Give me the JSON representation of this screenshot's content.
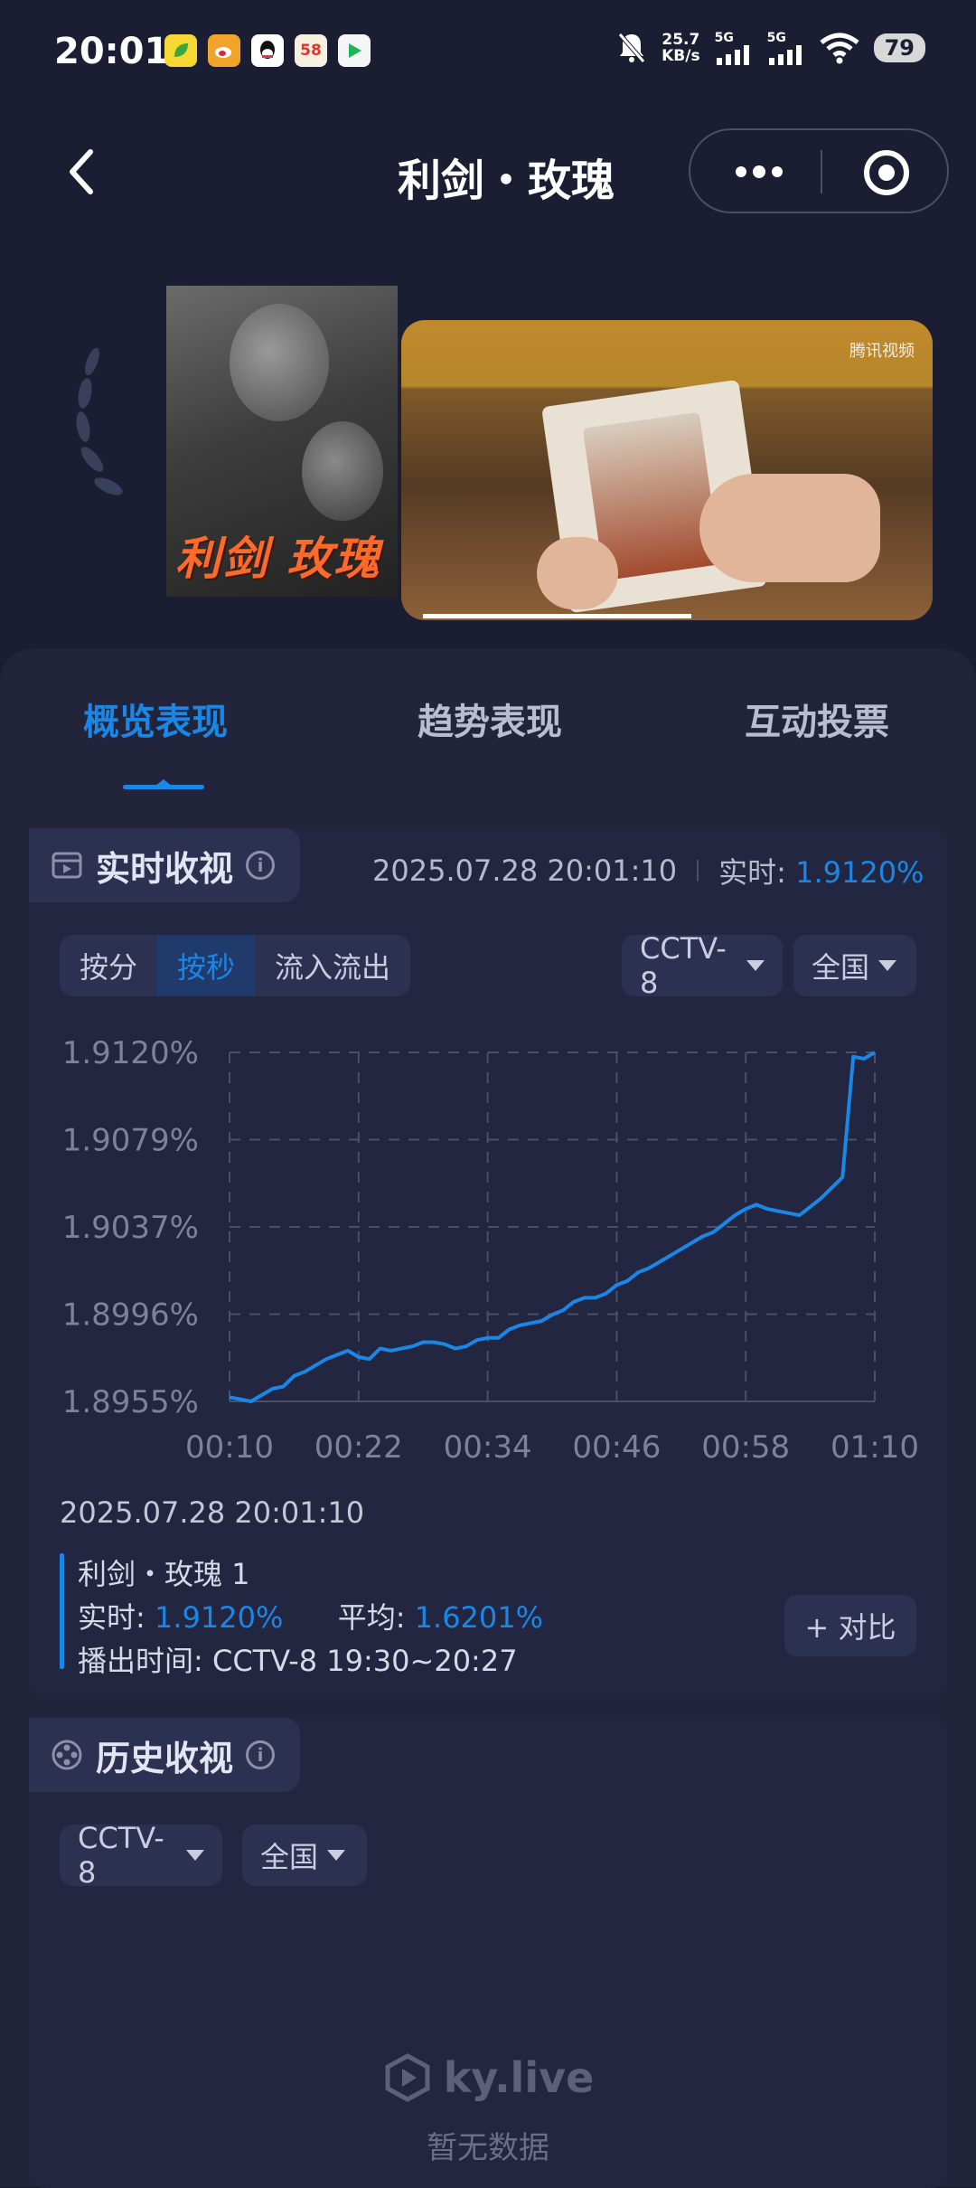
{
  "status_bar": {
    "time": "20:01",
    "net_speed_value": "25.7",
    "net_speed_unit": "KB/s",
    "signal_1": "5G",
    "signal_2": "5G",
    "battery": "79",
    "app_icons": [
      "leaf-app-icon",
      "weibo-icon",
      "qq-icon",
      "58-app-icon",
      "tencent-video-icon"
    ],
    "app_58_label": "58"
  },
  "nav": {
    "title": "利剑・玫瑰",
    "more_icon": "more-dots-icon",
    "record_icon": "target-icon"
  },
  "media": {
    "poster_title": "利剑 玫瑰",
    "watermark": "腾讯视频",
    "video_progress": 0.55
  },
  "tabs": [
    {
      "label": "概览表现",
      "active": true
    },
    {
      "label": "趋势表现",
      "active": false
    },
    {
      "label": "互动投票",
      "active": false
    }
  ],
  "realtime": {
    "title": "实时收视",
    "timestamp": "2025.07.28 20:01:10",
    "realtime_label": "实时:",
    "realtime_value": "1.9120%",
    "segments": [
      {
        "label": "按分",
        "active": false
      },
      {
        "label": "按秒",
        "active": true
      },
      {
        "label": "流入流出",
        "active": false
      }
    ],
    "channel": "CCTV-8",
    "region": "全国"
  },
  "chart_data": {
    "type": "line",
    "title": "",
    "xlabel": "",
    "ylabel": "",
    "x_ticks": [
      "00:10",
      "00:22",
      "00:34",
      "00:46",
      "00:58",
      "01:10"
    ],
    "y_ticks": [
      "1.9120%",
      "1.9079%",
      "1.9037%",
      "1.8996%",
      "1.8955%"
    ],
    "ylim": [
      1.8955,
      1.912
    ],
    "xlim": [
      10,
      70
    ],
    "grid": true,
    "color": "#1a87e6",
    "series": [
      {
        "x": [
          10,
          11,
          12,
          13,
          14,
          15,
          16,
          17,
          18,
          19,
          20,
          21,
          22,
          23,
          24,
          25,
          26,
          27,
          28,
          29,
          30,
          31,
          32,
          33,
          34,
          35,
          36,
          37,
          38,
          39,
          40,
          41,
          42,
          43,
          44,
          45,
          46,
          47,
          48,
          49,
          50,
          51,
          52,
          53,
          54,
          55,
          56,
          57,
          58,
          59,
          60,
          61,
          62,
          63,
          64,
          65,
          66,
          67,
          68,
          69,
          70
        ],
        "y": [
          1.8957,
          1.8956,
          1.8955,
          1.8958,
          1.8961,
          1.8962,
          1.8967,
          1.8969,
          1.8972,
          1.8975,
          1.8977,
          1.8979,
          1.8976,
          1.8975,
          1.898,
          1.8979,
          1.898,
          1.8981,
          1.8983,
          1.8983,
          1.8982,
          1.898,
          1.8981,
          1.8984,
          1.8985,
          1.8985,
          1.8989,
          1.8991,
          1.8992,
          1.8993,
          1.8996,
          1.8998,
          1.9002,
          1.9004,
          1.9004,
          1.9006,
          1.901,
          1.9012,
          1.9016,
          1.9018,
          1.9021,
          1.9024,
          1.9027,
          1.903,
          1.9033,
          1.9035,
          1.9039,
          1.9043,
          1.9046,
          1.9048,
          1.9046,
          1.9045,
          1.9044,
          1.9043,
          1.9047,
          1.9051,
          1.9056,
          1.9061,
          1.9118,
          1.9117,
          1.912
        ]
      }
    ]
  },
  "tooltip": {
    "date": "2025.07.28 20:01:10",
    "program": "利剑・玫瑰 1",
    "realtime_label": "实时:",
    "realtime_value": "1.9120%",
    "average_label": "平均:",
    "average_value": "1.6201%",
    "airtime_label": "播出时间:",
    "airtime_value": "CCTV-8 19:30~20:27",
    "compare_button": "+ 对比"
  },
  "history": {
    "title": "历史收视",
    "channel": "CCTV-8",
    "region": "全国",
    "empty_brand": "ky.live",
    "empty_text": "暂无数据"
  }
}
